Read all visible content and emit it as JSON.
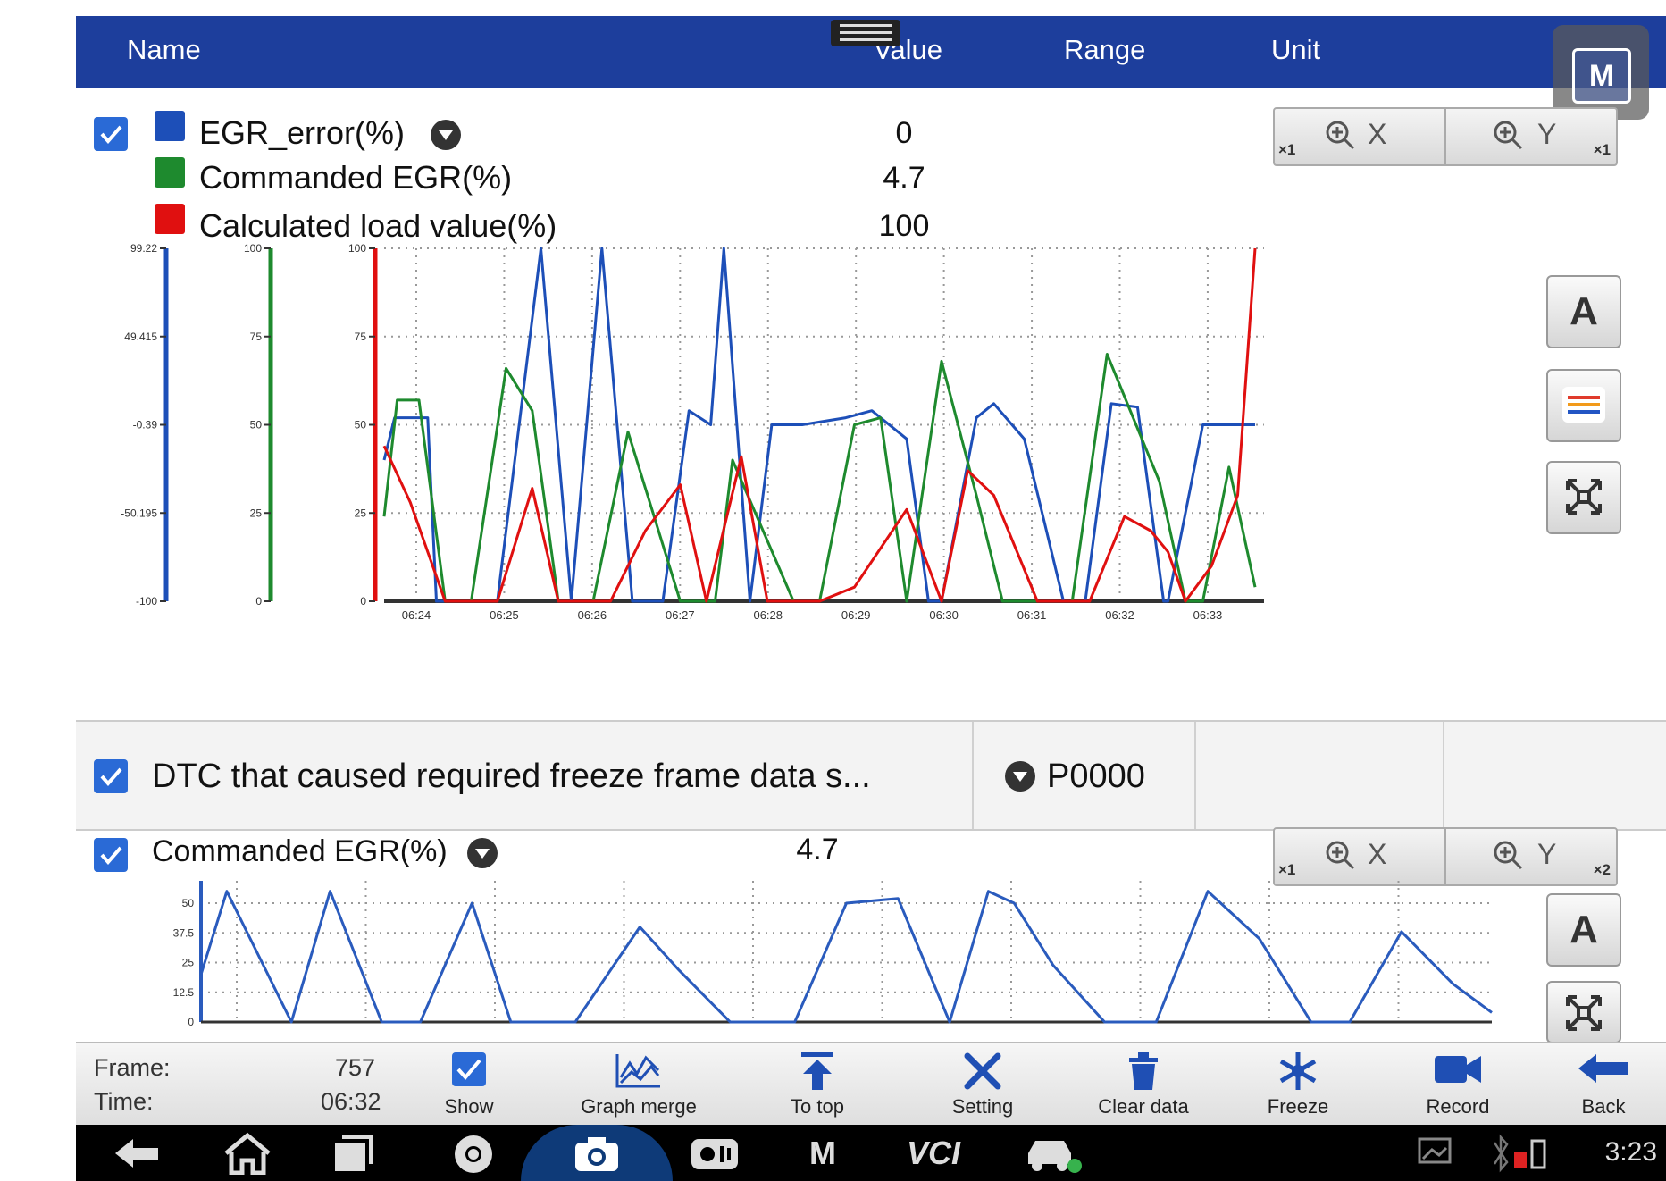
{
  "header": {
    "name_label": "Name",
    "value_label": "Value",
    "range_label": "Range",
    "unit_label": "Unit"
  },
  "float_button": {
    "label": "M"
  },
  "panel1": {
    "params": [
      {
        "name": "EGR_error(%)",
        "value": "0",
        "color": "#1d4fb8"
      },
      {
        "name": "Commanded EGR(%)",
        "value": "4.7",
        "color": "#1e8a2e"
      },
      {
        "name": "Calculated load value(%)",
        "value": "100",
        "color": "#e01010"
      }
    ],
    "zoom_x_label": "X",
    "zoom_x_mult": "×1",
    "zoom_y_label": "Y",
    "zoom_y_mult": "×1",
    "side_buttons": {
      "font_label": "A"
    }
  },
  "dtc_row": {
    "name": "DTC that caused required freeze frame data s...",
    "value": "P0000"
  },
  "panel2": {
    "name": "Commanded EGR(%)",
    "value": "4.7",
    "zoom_x_label": "X",
    "zoom_x_mult": "×1",
    "zoom_y_label": "Y",
    "zoom_y_mult": "×2",
    "side_buttons": {
      "font_label": "A"
    }
  },
  "chart_data": [
    {
      "type": "line",
      "x_ticks": [
        "06:24",
        "06:25",
        "06:26",
        "06:27",
        "06:28",
        "06:29",
        "06:30",
        "06:31",
        "06:32",
        "06:33"
      ],
      "axes": [
        {
          "series": "EGR_error(%)",
          "ticks": [
            "99.22",
            "49.415",
            "-0.39",
            "-50.195",
            "-100"
          ],
          "range": [
            -100,
            99.22
          ],
          "color": "#1d4fb8"
        },
        {
          "series": "Commanded EGR(%)",
          "ticks": [
            "100",
            "75",
            "50",
            "25",
            "0"
          ],
          "range": [
            0,
            100
          ],
          "color": "#1e8a2e"
        },
        {
          "series": "Calculated load value(%)",
          "ticks": [
            "100",
            "75",
            "50",
            "25",
            "0"
          ],
          "range": [
            0,
            100
          ],
          "color": "#e01010"
        }
      ],
      "grid": true,
      "series": [
        {
          "name": "EGR_error(%)",
          "color": "#1d4fb8",
          "xfrac": [
            0,
            0.012,
            0.05,
            0.06,
            0.1,
            0.13,
            0.18,
            0.215,
            0.25,
            0.285,
            0.32,
            0.35,
            0.375,
            0.39,
            0.42,
            0.445,
            0.46,
            0.48,
            0.53,
            0.56,
            0.6,
            0.625,
            0.64,
            0.68,
            0.7,
            0.735,
            0.78,
            0.805,
            0.835,
            0.865,
            0.895,
            0.9,
            0.94,
            0.945,
            0.965,
            0.99,
            1.0
          ],
          "values": [
            40,
            52,
            52,
            0,
            0,
            0,
            100,
            0,
            100,
            0,
            0,
            54,
            50,
            100,
            0,
            50,
            50,
            50,
            52,
            54,
            46,
            0,
            0,
            52,
            56,
            46,
            0,
            0,
            56,
            55,
            0,
            0,
            50,
            50,
            50,
            50,
            50
          ]
        },
        {
          "name": "Commanded EGR(%)",
          "color": "#1e8a2e",
          "xfrac": [
            0,
            0.015,
            0.04,
            0.07,
            0.1,
            0.14,
            0.17,
            0.2,
            0.24,
            0.28,
            0.34,
            0.38,
            0.4,
            0.47,
            0.5,
            0.54,
            0.57,
            0.6,
            0.64,
            0.68,
            0.71,
            0.75,
            0.79,
            0.83,
            0.86,
            0.89,
            0.92,
            0.94,
            0.97,
            1.0
          ],
          "values": [
            24,
            57,
            57,
            0,
            0,
            66,
            54,
            0,
            0,
            48,
            0,
            0,
            40,
            0,
            0,
            50,
            52,
            0,
            68,
            30,
            0,
            0,
            0,
            70,
            52,
            34,
            0,
            0,
            38,
            4
          ]
        },
        {
          "name": "Calculated load value(%)",
          "color": "#e01010",
          "xfrac": [
            0,
            0.03,
            0.07,
            0.1,
            0.13,
            0.17,
            0.2,
            0.24,
            0.26,
            0.3,
            0.34,
            0.37,
            0.41,
            0.44,
            0.47,
            0.5,
            0.54,
            0.6,
            0.64,
            0.67,
            0.7,
            0.75,
            0.78,
            0.81,
            0.85,
            0.88,
            0.9,
            0.92,
            0.95,
            0.98,
            1.0
          ],
          "values": [
            44,
            28,
            0,
            0,
            0,
            32,
            0,
            0,
            0,
            20,
            33,
            0,
            41,
            0,
            0,
            0,
            4,
            26,
            0,
            37,
            30,
            0,
            0,
            0,
            24,
            20,
            14,
            0,
            10,
            30,
            100
          ]
        }
      ]
    },
    {
      "type": "line",
      "y_ticks": [
        "50",
        "37.5",
        "25",
        "12.5",
        "0"
      ],
      "ylim": [
        0,
        50
      ],
      "grid": true,
      "series": [
        {
          "name": "Commanded EGR(%)",
          "color": "#2a5bbd",
          "xfrac": [
            0,
            0.02,
            0.07,
            0.1,
            0.14,
            0.17,
            0.21,
            0.24,
            0.29,
            0.34,
            0.37,
            0.41,
            0.46,
            0.5,
            0.54,
            0.58,
            0.61,
            0.63,
            0.66,
            0.7,
            0.74,
            0.78,
            0.82,
            0.86,
            0.89,
            0.93,
            0.97,
            1.0
          ],
          "values": [
            20,
            55,
            0,
            55,
            0,
            0,
            50,
            0,
            0,
            40,
            22,
            0,
            0,
            50,
            52,
            0,
            55,
            50,
            24,
            0,
            0,
            55,
            35,
            0,
            0,
            38,
            16,
            4
          ]
        }
      ]
    }
  ],
  "footer": {
    "frame_label": "Frame:",
    "frame_value": "757",
    "time_label": "Time:",
    "time_value": "06:32",
    "tools": [
      "Show",
      "Graph merge",
      "To top",
      "Setting",
      "Clear data",
      "Freeze",
      "Record",
      "Back"
    ]
  },
  "navbar": {
    "time": "3:23",
    "vci_label": "VCI",
    "m_label": "M"
  }
}
